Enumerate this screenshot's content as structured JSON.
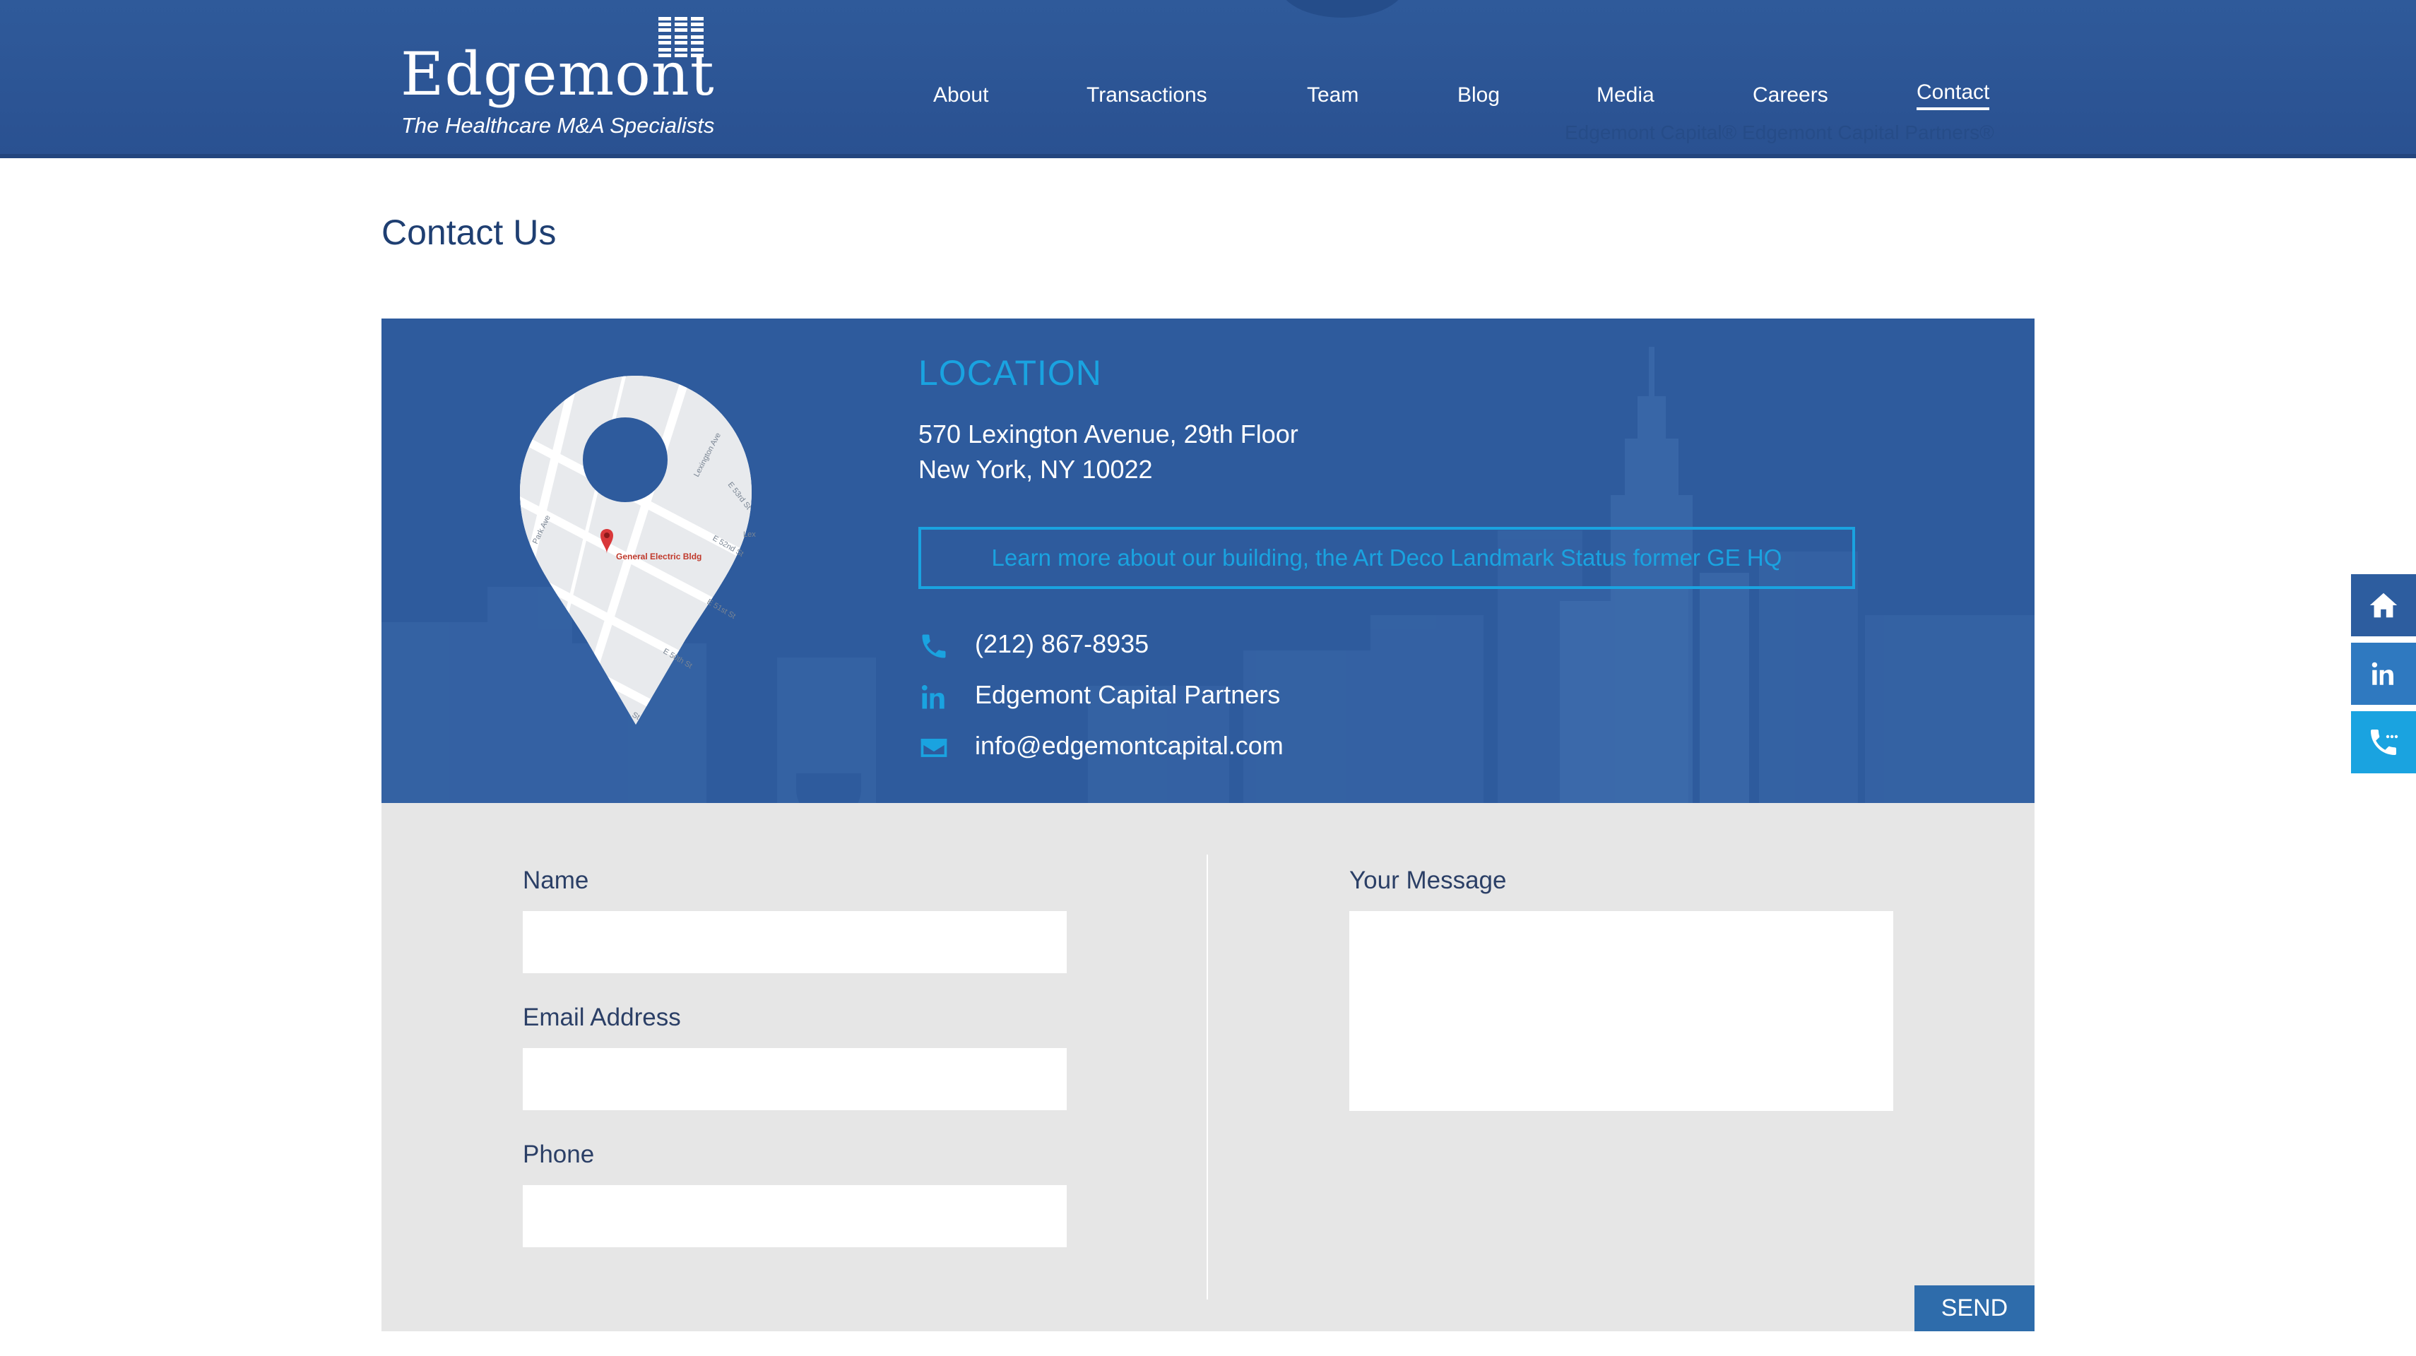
{
  "header": {
    "logo": {
      "wordmark": "Edgemont",
      "tagline": "The Healthcare M&A Specialists",
      "icon": "building-grid-icon"
    },
    "nav": [
      {
        "label": "About",
        "active": false
      },
      {
        "label": "Transactions",
        "active": false
      },
      {
        "label": "Team",
        "active": false
      },
      {
        "label": "Blog",
        "active": false
      },
      {
        "label": "Media",
        "active": false
      },
      {
        "label": "Careers",
        "active": false
      },
      {
        "label": "Contact",
        "active": true
      }
    ],
    "ghost_text": "Edgemont Capital® Edgemont Capital Partners®"
  },
  "page": {
    "title": "Contact Us"
  },
  "location": {
    "heading": "LOCATION",
    "address_line1": "570 Lexington Avenue, 29th Floor",
    "address_line2": "New York, NY 10022",
    "building_link": "Learn more about our building, the Art Deco Landmark Status former GE HQ",
    "map": {
      "marker_label": "General Electric Bldg",
      "streets": [
        "Lexington Ave",
        "Park Ave",
        "E 53rd St",
        "E 52nd St",
        "E 51st St",
        "E 50th St",
        "St",
        "Lex"
      ]
    },
    "phone": {
      "icon": "phone-icon",
      "text": "(212) 867-8935"
    },
    "linkedin": {
      "icon": "linkedin-icon",
      "text": "Edgemont Capital Partners"
    },
    "email": {
      "icon": "envelope-icon",
      "text": "info@edgemontcapital.com"
    }
  },
  "form": {
    "name_label": "Name",
    "name_value": "",
    "email_label": "Email Address",
    "email_value": "",
    "phone_label": "Phone",
    "phone_value": "",
    "message_label": "Your Message",
    "message_value": "",
    "send_label": "SEND"
  },
  "side_tabs": [
    {
      "icon": "home-icon",
      "color": "#2d5d9f"
    },
    {
      "icon": "linkedin-icon",
      "color": "#2f79c0"
    },
    {
      "icon": "phone-chat-icon",
      "color": "#1aa3e0"
    }
  ],
  "colors": {
    "brand_blue": "#2e5b9d",
    "accent_cyan": "#1aa3e0",
    "form_gray": "#e6e6e6",
    "button_blue": "#2e6cab"
  }
}
